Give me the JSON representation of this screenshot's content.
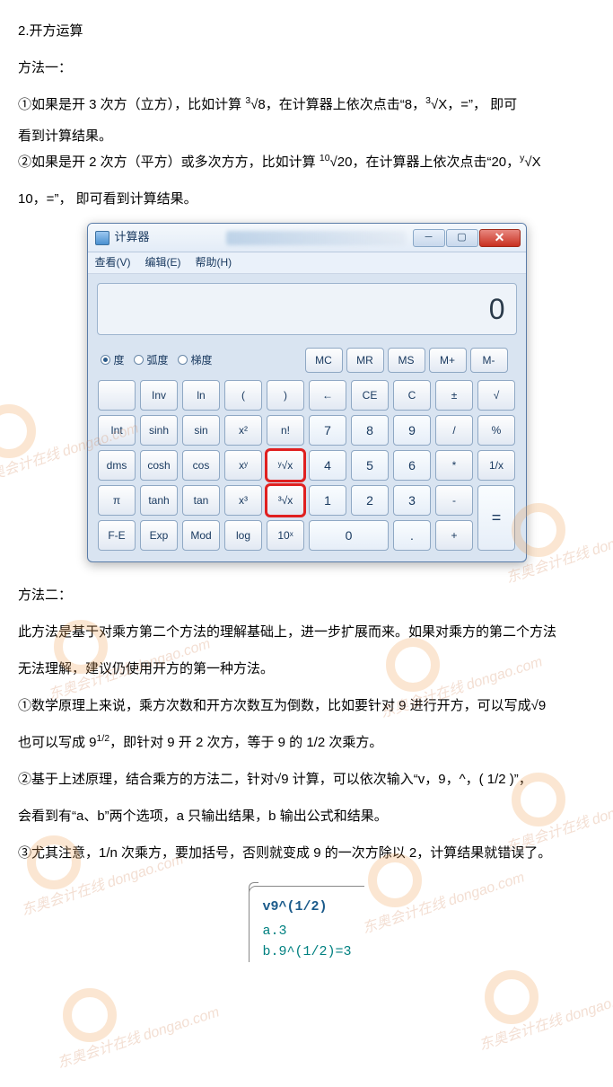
{
  "doc": {
    "h1": "2.开方运算",
    "m1_title": "方法一：",
    "m1_p1_a": "①如果是开 3 次方（立方），比如计算 ",
    "m1_p1_sup": "3",
    "m1_p1_b": "√8，在计算器上依次点击“8，",
    "m1_p1_sup2": "3",
    "m1_p1_c": "√X，=”， 即可",
    "m1_p2": "看到计算结果。",
    "m1_p3_a": "②如果是开 2 次方（平方）或多次方方，比如计算 ",
    "m1_p3_sup": "10",
    "m1_p3_b": "√20，在计算器上依次点击“20，",
    "m1_p3_sup2": "y",
    "m1_p3_c": "√X",
    "m1_p4": "10，=”， 即可看到计算结果。",
    "m2_title": "方法二：",
    "m2_p1": "此方法是基于对乘方第二个方法的理解基础上，进一步扩展而来。如果对乘方的第二个方法",
    "m2_p2": "无法理解，建议仍使用开方的第一种方法。",
    "m2_p3": "①数学原理上来说，乘方次数和开方次数互为倒数，比如要针对 9 进行开方，可以写成√9",
    "m2_p4_a": "也可以写成 9",
    "m2_p4_sup": "1/2",
    "m2_p4_b": "，即针对 9 开 2 次方，等于 9 的 1/2 次乘方。",
    "m2_p5": "②基于上述原理，结合乘方的方法二，针对√9 计算，可以依次输入“v，9，^，( 1/2 )”，",
    "m2_p6": "会看到有“a、b”两个选项，a 只输出结果，b 输出公式和结果。",
    "m2_p7": "③尤其注意，1/n 次乘方，要加括号，否则就变成 9 的一次方除以 2，计算结果就错误了。"
  },
  "calc": {
    "title": "计算器",
    "menu": {
      "view": "查看(V)",
      "edit": "编辑(E)",
      "help": "帮助(H)"
    },
    "display": "0",
    "modes": {
      "deg": "度",
      "rad": "弧度",
      "grad": "梯度"
    },
    "mem": [
      "MC",
      "MR",
      "MS",
      "M+",
      "M-"
    ],
    "rows": [
      [
        "",
        "Inv",
        "ln",
        "(",
        ")",
        "←",
        "CE",
        "C",
        "±",
        "√"
      ],
      [
        "Int",
        "sinh",
        "sin",
        "x²",
        "n!",
        "7",
        "8",
        "9",
        "/",
        "%"
      ],
      [
        "dms",
        "cosh",
        "cos",
        "xʸ",
        "ʸ√x",
        "4",
        "5",
        "6",
        "*",
        "1/x"
      ],
      [
        "π",
        "tanh",
        "tan",
        "x³",
        "³√x",
        "1",
        "2",
        "3",
        "-",
        "="
      ],
      [
        "F-E",
        "Exp",
        "Mod",
        "log",
        "10ˣ",
        "0",
        ".",
        "+"
      ]
    ]
  },
  "code": {
    "l1": "v9^(1/2)",
    "l2": "a.3",
    "l3": "b.9^(1/2)=3"
  },
  "watermark": "东奥会计在线 dongao.com"
}
